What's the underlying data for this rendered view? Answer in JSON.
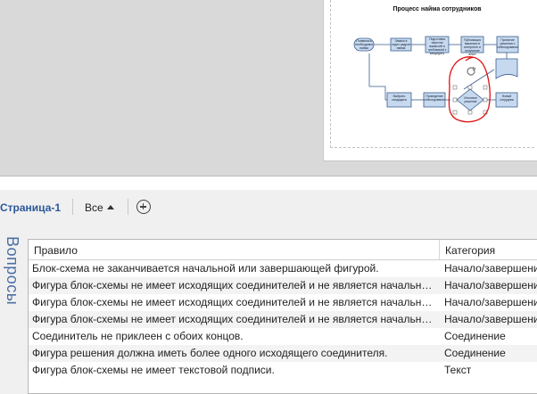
{
  "diagram": {
    "title": "Процесс найма сотрудников",
    "shapes": [
      {
        "id": "s1",
        "label": "Появилась необходимость найма"
      },
      {
        "id": "s2",
        "label": "Заявка в отдел кадров найма"
      },
      {
        "id": "s3",
        "label": "Подготовка перечня вакансий и требований к кандидату"
      },
      {
        "id": "s4",
        "label": "Публикация вакансии в интернете и получение анкет"
      },
      {
        "id": "s5",
        "label": "Принятие решения о собеседовании"
      },
      {
        "id": "s6",
        "label": "Новый сотрудник"
      },
      {
        "id": "s7",
        "label": "Итоговое решение"
      },
      {
        "id": "s8",
        "label": "Проведение собеседования"
      },
      {
        "id": "s9",
        "label": "Выбрать кандидата"
      }
    ],
    "colors": {
      "shape_fill": "#c7d9ef",
      "shape_stroke": "#3a5f8f",
      "annotation": "#e01010"
    }
  },
  "tabs": {
    "page_tab": "Страница-1",
    "filter_label": "Все",
    "add_icon": "plus-circle-icon"
  },
  "issues": {
    "pane_title": "Вопросы",
    "columns": {
      "rule": "Правило",
      "category": "Категория"
    },
    "rows": [
      {
        "rule": "Блок-схема не заканчивается начальной или завершающей фигурой.",
        "category": "Начало/завершение"
      },
      {
        "rule": "Фигура блок-схемы не имеет исходящих соединителей и не является начальной...",
        "category": "Начало/завершение"
      },
      {
        "rule": "Фигура блок-схемы не имеет исходящих соединителей и не является начальной...",
        "category": "Начало/завершение"
      },
      {
        "rule": "Фигура блок-схемы не имеет исходящих соединителей и не является начальной...",
        "category": "Начало/завершение"
      },
      {
        "rule": "Соединитель не приклеен с обоих концов.",
        "category": "Соединение"
      },
      {
        "rule": "Фигура решения должна иметь более одного исходящего соединителя.",
        "category": "Соединение"
      },
      {
        "rule": "Фигура блок-схемы не имеет текстовой подписи.",
        "category": "Текст"
      }
    ]
  }
}
